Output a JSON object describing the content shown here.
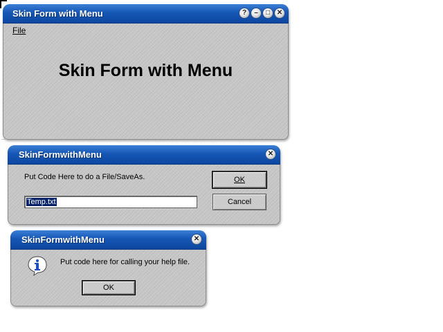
{
  "main_window": {
    "title": "Skin Form with Menu",
    "menu": {
      "file_label": "File"
    },
    "heading": "Skin Form with Menu",
    "title_buttons": {
      "help": "?",
      "minimize": "–",
      "maximize": "□",
      "close": "✕"
    }
  },
  "saveas_dialog": {
    "title": "SkinFormwithMenu",
    "message": "Put Code Here to do a File/SaveAs.",
    "filename_value": "Temp.txt",
    "ok_label": "OK",
    "cancel_label": "Cancel",
    "close_glyph": "✕"
  },
  "help_dialog": {
    "title": "SkinFormwithMenu",
    "message": "Put code here for calling your help file.",
    "ok_label": "OK",
    "close_glyph": "✕",
    "icon": "info-icon"
  },
  "colors": {
    "titlebar": "#1657b5",
    "window_body": "#c6c6c6",
    "selection": "#0a246a"
  }
}
